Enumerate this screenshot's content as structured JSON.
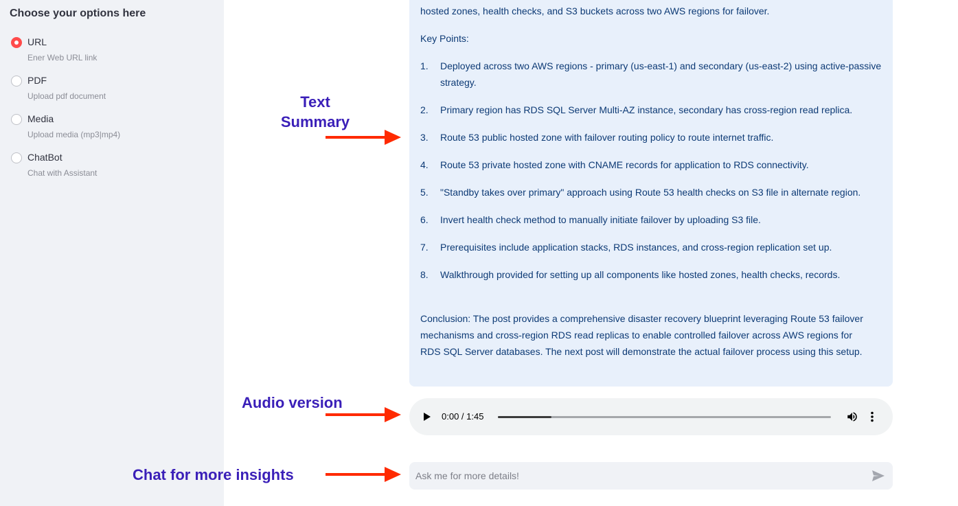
{
  "sidebar": {
    "title": "Choose your options here",
    "options": [
      {
        "label": "URL",
        "caption": "Ener Web URL link",
        "selected": true
      },
      {
        "label": "PDF",
        "caption": "Upload pdf document",
        "selected": false
      },
      {
        "label": "Media",
        "caption": "Upload media (mp3|mp4)",
        "selected": false
      },
      {
        "label": "ChatBot",
        "caption": "Chat with Assistant",
        "selected": false
      }
    ]
  },
  "summary": {
    "intro": "hosted zones, health checks, and S3 buckets across two AWS regions for failover.",
    "key_points_heading": "Key Points:",
    "key_points": [
      {
        "num": "1.",
        "text": "Deployed across two AWS regions - primary (us-east-1) and secondary (us-east-2) using active-passive strategy."
      },
      {
        "num": "2.",
        "text": "Primary region has RDS SQL Server Multi-AZ instance, secondary has cross-region read replica."
      },
      {
        "num": "3.",
        "text": "Route 53 public hosted zone with failover routing policy to route internet traffic."
      },
      {
        "num": "4.",
        "text": "Route 53 private hosted zone with CNAME records for application to RDS connectivity."
      },
      {
        "num": "5.",
        "text": "\"Standby takes over primary\" approach using Route 53 health checks on S3 file in alternate region."
      },
      {
        "num": "6.",
        "text": "Invert health check method to manually initiate failover by uploading S3 file."
      },
      {
        "num": "7.",
        "text": "Prerequisites include application stacks, RDS instances, and cross-region replication set up."
      },
      {
        "num": "8.",
        "text": "Walkthrough provided for setting up all components like hosted zones, health checks, records."
      }
    ],
    "conclusion": "Conclusion: The post provides a comprehensive disaster recovery blueprint leveraging Route 53 failover mechanisms and cross-region RDS read replicas to enable controlled failover across AWS regions for RDS SQL Server databases. The next post will demonstrate the actual failover process using this setup."
  },
  "annotations": {
    "text_summary_line1": "Text",
    "text_summary_line2": "Summary",
    "audio_version": "Audio version",
    "chat_insights": "Chat for more insights",
    "color": "#3a1fb8",
    "arrow_color": "#ff2a00"
  },
  "audio": {
    "time": "0:00 / 1:45",
    "progress": 0.16
  },
  "chat": {
    "placeholder": "Ask me for more details!"
  },
  "colors": {
    "accent": "#ff4b4b",
    "summary_bg": "#e8f0fb",
    "summary_text": "#0d3a75",
    "sidebar_bg": "#f0f2f6"
  }
}
